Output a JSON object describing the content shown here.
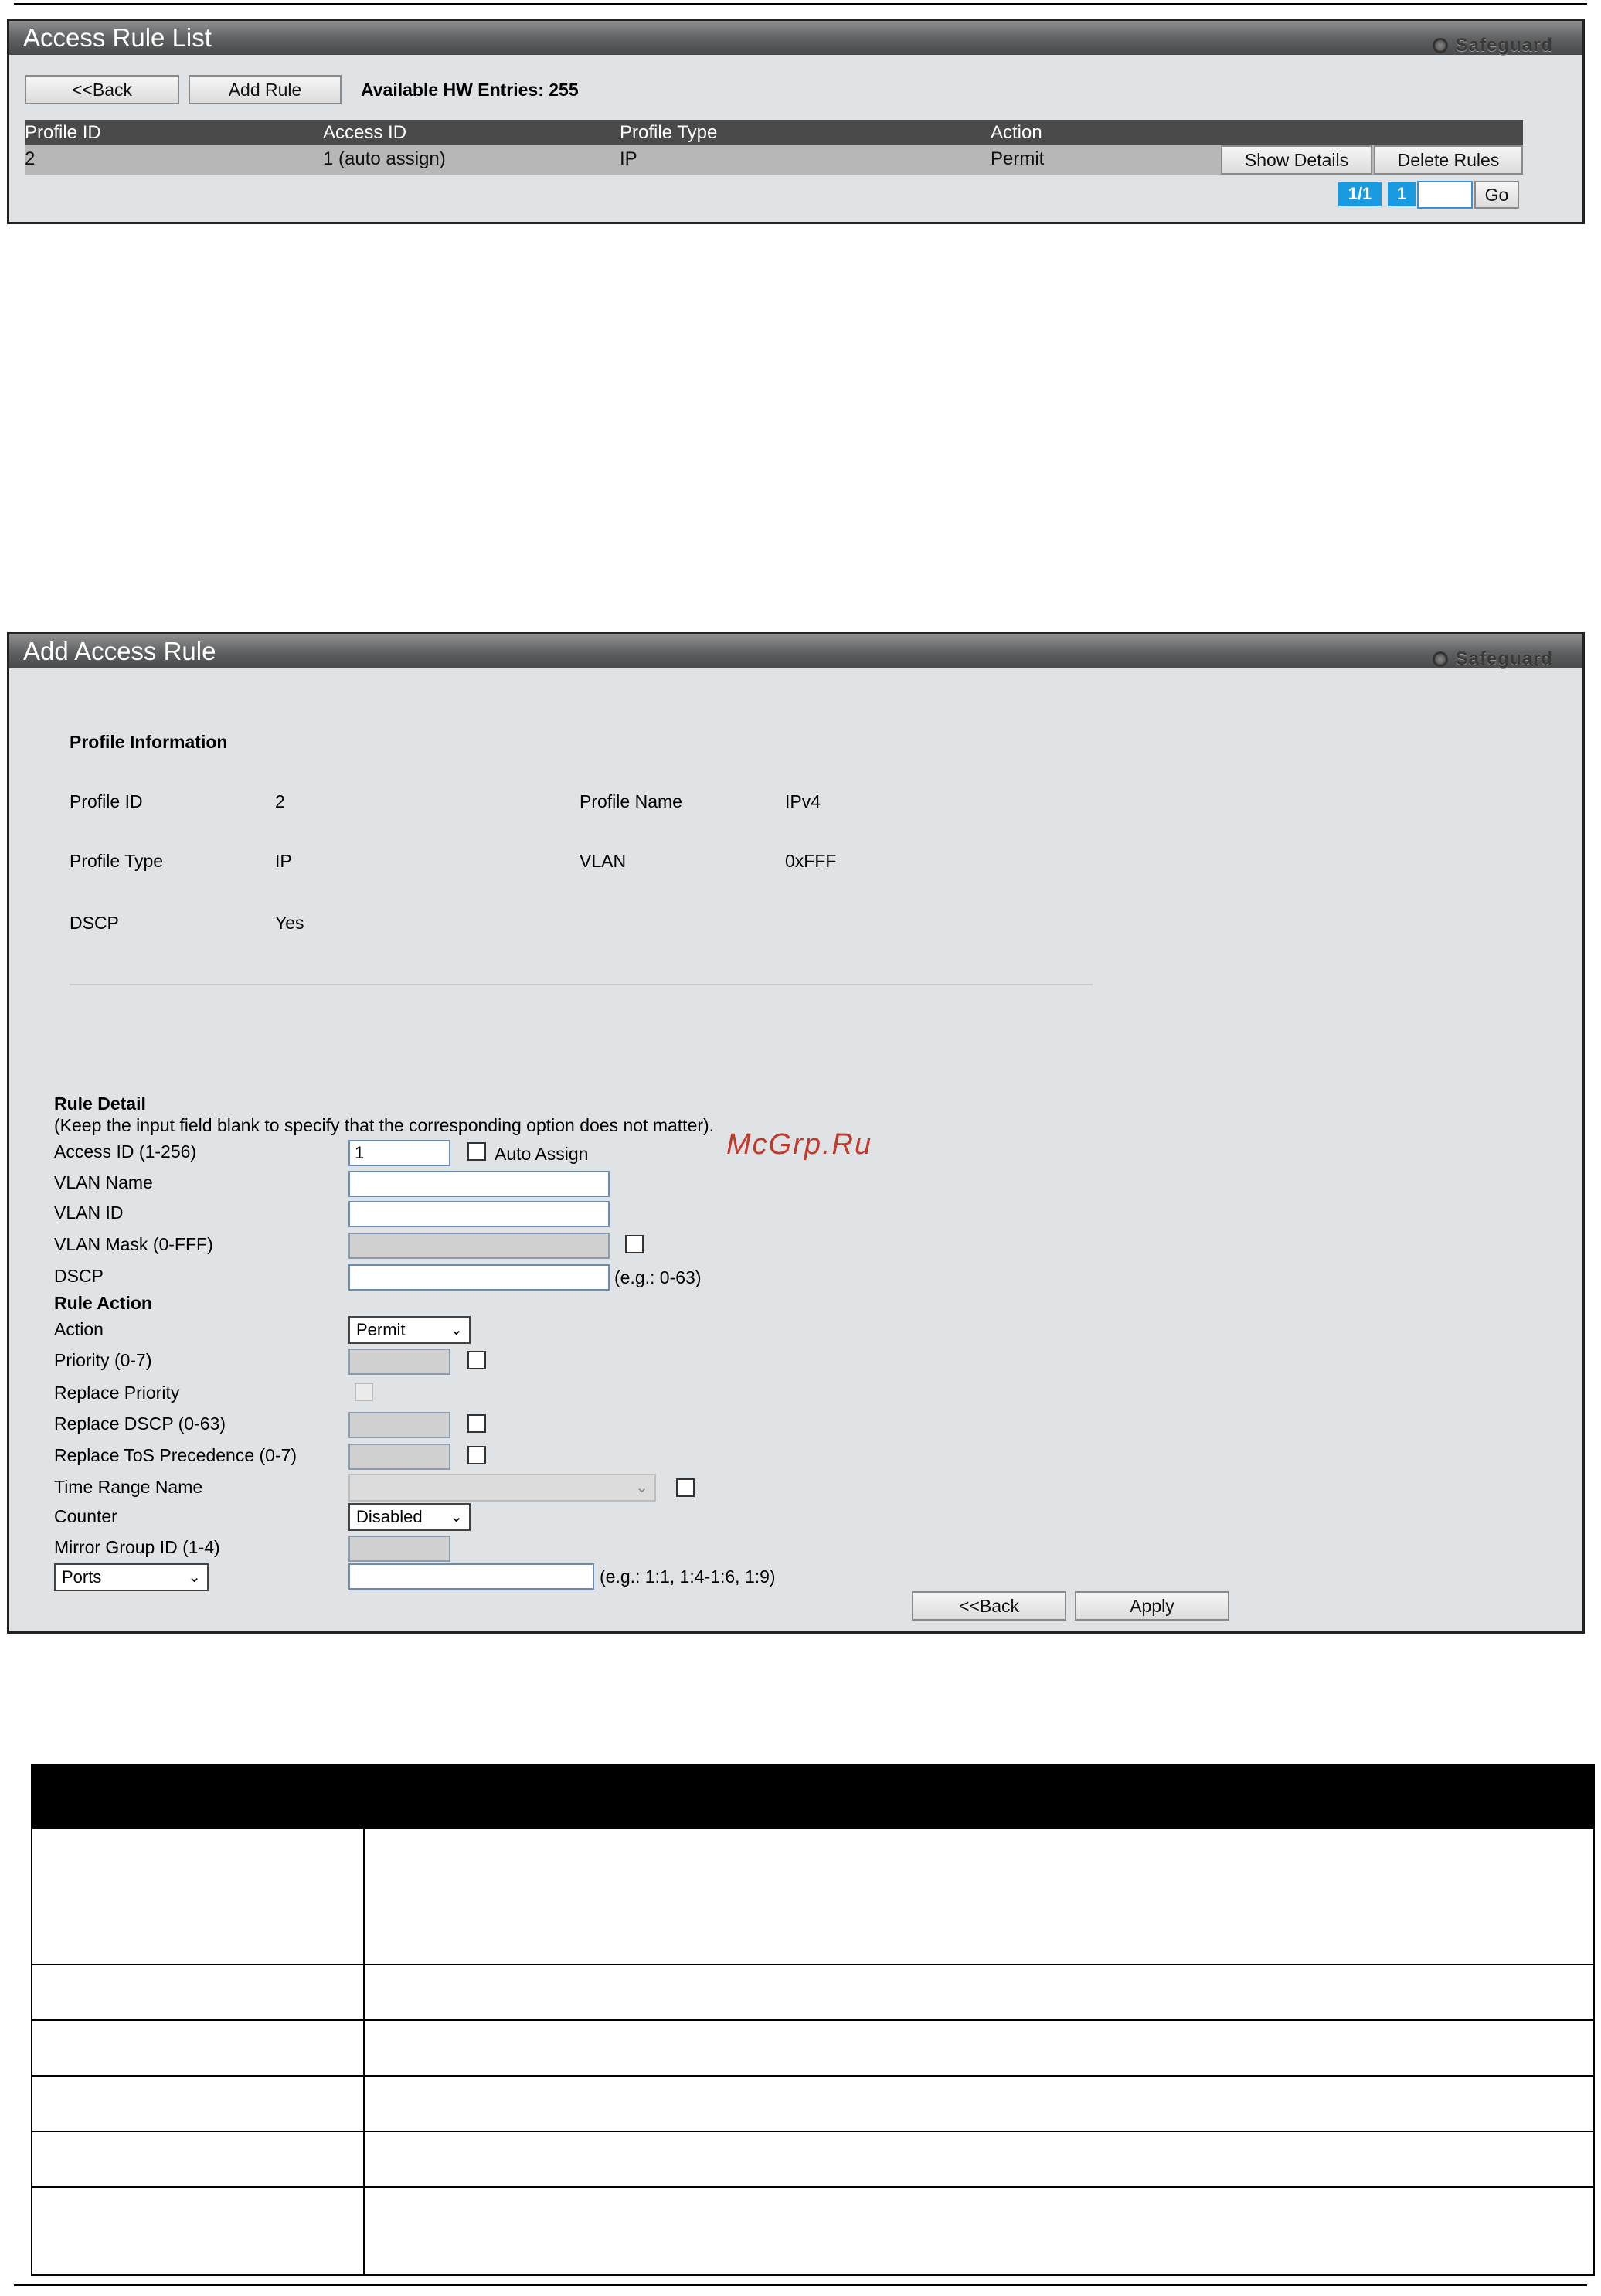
{
  "access_rule_list": {
    "title": "Access Rule List",
    "safeguard": "Safeguard",
    "back_label": "<<Back",
    "add_rule_label": "Add Rule",
    "available_entries": "Available HW Entries: 255",
    "columns": [
      "Profile ID",
      "Access ID",
      "Profile Type",
      "Action"
    ],
    "rows": [
      {
        "profile_id": "2",
        "access_id": "1 (auto assign)",
        "profile_type": "IP",
        "action": "Permit",
        "show_details_label": "Show Details",
        "delete_rules_label": "Delete Rules"
      }
    ],
    "pagination": {
      "page_of": "1/1",
      "current": "1",
      "go_label": "Go"
    }
  },
  "add_access_rule": {
    "title": "Add Access Rule",
    "safeguard": "Safeguard",
    "profile_info_heading": "Profile Information",
    "profile": {
      "profile_id_label": "Profile ID",
      "profile_id": "2",
      "profile_name_label": "Profile Name",
      "profile_name": "IPv4",
      "profile_type_label": "Profile Type",
      "profile_type": "IP",
      "vlan_label": "VLAN",
      "vlan": "0xFFF",
      "dscp_label": "DSCP",
      "dscp": "Yes"
    },
    "rule_detail_heading": "Rule Detail",
    "rule_detail_note": "(Keep the input field blank to specify that the corresponding option does not matter).",
    "fields": {
      "access_id_label": "Access ID (1-256)",
      "access_id_value": "1",
      "auto_assign_label": "Auto Assign",
      "vlan_name_label": "VLAN Name",
      "vlan_id_label": "VLAN ID",
      "vlan_mask_label": "VLAN Mask (0-FFF)",
      "dscp_label": "DSCP",
      "dscp_hint": "(e.g.: 0-63)"
    },
    "rule_action_heading": "Rule Action",
    "action": {
      "action_label": "Action",
      "action_value": "Permit",
      "priority_label": "Priority  (0-7)",
      "replace_priority_label": "Replace Priority",
      "replace_dscp_label": "Replace DSCP  (0-63)",
      "replace_tos_label": "Replace ToS Precedence  (0-7)",
      "time_range_label": "Time Range Name",
      "counter_label": "Counter",
      "counter_value": "Disabled",
      "mirror_group_label": "Mirror Group ID (1-4)",
      "ports_select_value": "Ports",
      "ports_hint": "(e.g.: 1:1, 1:4-1:6, 1:9)"
    },
    "back_label": "<<Back",
    "apply_label": "Apply"
  },
  "watermark": "McGrp.Ru",
  "colors": {
    "panel_bg": "#dfe3e5",
    "title_bar": "#5d5f61",
    "table_head": "#4a4a4a",
    "page_badge": "#1a9ae0"
  }
}
